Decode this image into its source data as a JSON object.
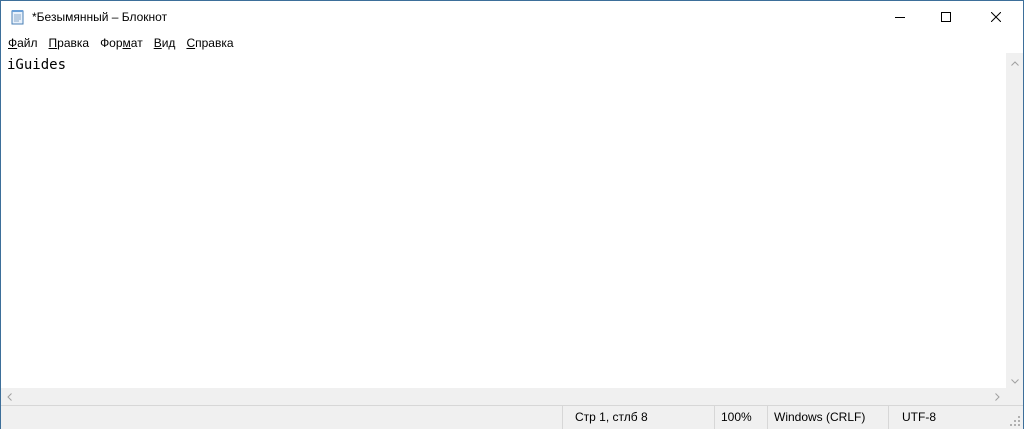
{
  "window": {
    "title": "*Безымянный – Блокнот",
    "icons": {
      "app": "notepad-icon",
      "minimize": "minimize-icon",
      "maximize": "maximize-icon",
      "close": "close-icon"
    }
  },
  "menu": {
    "items": [
      {
        "accel": "Ф",
        "rest": "айл"
      },
      {
        "accel": "П",
        "rest": "равка"
      },
      {
        "accel": "",
        "rest": "Фор",
        "accel2": "м",
        "rest2": "ат"
      },
      {
        "accel": "В",
        "rest": "ид"
      },
      {
        "accel": "С",
        "rest": "правка"
      }
    ]
  },
  "editor": {
    "content": "iGuides"
  },
  "status": {
    "position": "Стр 1, стлб 8",
    "zoom": "100%",
    "line_endings": "Windows (CRLF)",
    "encoding": "UTF-8"
  },
  "colors": {
    "frame": "#3d6f9a",
    "chrome": "#f0f0f0",
    "editor_bg": "#ffffff"
  }
}
